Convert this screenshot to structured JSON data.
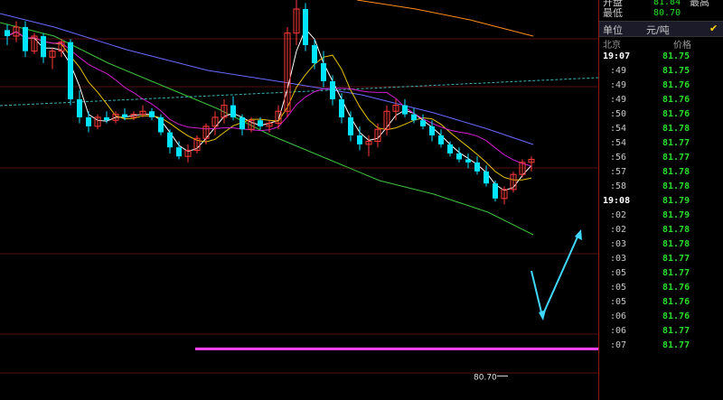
{
  "sidebar": {
    "open_label": "开盘",
    "open_value": "81.84",
    "open_extra": "最高",
    "low_label": "最低",
    "low_value": "80.70",
    "unit_label": "单位",
    "unit_value": "元/吨",
    "col_time": "北京",
    "col_price": "价格",
    "ticks": [
      {
        "time": "19:07",
        "price": "81.75",
        "major": true
      },
      {
        "time": ":49",
        "price": "81.75"
      },
      {
        "time": ":49",
        "price": "81.76"
      },
      {
        "time": ":49",
        "price": "81.76"
      },
      {
        "time": ":50",
        "price": "81.76"
      },
      {
        "time": ":54",
        "price": "81.78"
      },
      {
        "time": ":54",
        "price": "81.77"
      },
      {
        "time": ":56",
        "price": "81.77"
      },
      {
        "time": ":57",
        "price": "81.78"
      },
      {
        "time": ":58",
        "price": "81.78"
      },
      {
        "time": "19:08",
        "price": "81.79",
        "major": true
      },
      {
        "time": ":02",
        "price": "81.79"
      },
      {
        "time": ":02",
        "price": "81.78"
      },
      {
        "time": ":03",
        "price": "81.78"
      },
      {
        "time": ":03",
        "price": "81.77"
      },
      {
        "time": ":05",
        "price": "81.77"
      },
      {
        "time": ":05",
        "price": "81.76"
      },
      {
        "time": ":05",
        "price": "81.76"
      },
      {
        "time": ":06",
        "price": "81.76"
      },
      {
        "time": ":06",
        "price": "81.77"
      },
      {
        "time": ":07",
        "price": "81.77"
      }
    ]
  },
  "chart_data": {
    "type": "candlestick",
    "low_annotation": "80.70",
    "low_price": 80.7,
    "ylim": [
      80.62,
      81.95
    ],
    "colors": {
      "up": "#ff3b3b",
      "down": "#00e5ff",
      "ma1": "#ffffff",
      "ma2": "#e6c200",
      "ma3": "#d020d0",
      "ma4": "#3fc23f",
      "ma5": "#6a6aff",
      "ma6": "#ff8c1a",
      "support": "#ff44ff",
      "arrow": "#40d8ff"
    },
    "candles": [
      [
        81.85,
        81.87,
        81.8,
        81.83
      ],
      [
        81.83,
        81.88,
        81.81,
        81.86
      ],
      [
        81.86,
        81.88,
        81.76,
        81.78
      ],
      [
        81.78,
        81.84,
        81.77,
        81.83
      ],
      [
        81.83,
        81.84,
        81.74,
        81.76
      ],
      [
        81.76,
        81.79,
        81.72,
        81.78
      ],
      [
        81.78,
        81.82,
        81.76,
        81.81
      ],
      [
        81.81,
        81.82,
        81.6,
        81.62
      ],
      [
        81.62,
        81.65,
        81.54,
        81.56
      ],
      [
        81.56,
        81.58,
        81.51,
        81.53
      ],
      [
        81.53,
        81.57,
        81.52,
        81.56
      ],
      [
        81.56,
        81.58,
        81.54,
        81.55
      ],
      [
        81.55,
        81.58,
        81.54,
        81.57
      ],
      [
        81.57,
        81.59,
        81.55,
        81.56
      ],
      [
        81.56,
        81.58,
        81.55,
        81.57
      ],
      [
        81.57,
        81.6,
        81.56,
        81.58
      ],
      [
        81.58,
        81.59,
        81.55,
        81.56
      ],
      [
        81.56,
        81.57,
        81.5,
        81.51
      ],
      [
        81.51,
        81.52,
        81.44,
        81.46
      ],
      [
        81.46,
        81.48,
        81.42,
        81.43
      ],
      [
        81.43,
        81.47,
        81.41,
        81.45
      ],
      [
        81.45,
        81.5,
        81.44,
        81.49
      ],
      [
        81.49,
        81.54,
        81.47,
        81.53
      ],
      [
        81.53,
        81.58,
        81.5,
        81.56
      ],
      [
        81.56,
        81.62,
        81.54,
        81.6
      ],
      [
        81.6,
        81.63,
        81.55,
        81.56
      ],
      [
        81.56,
        81.57,
        81.5,
        81.52
      ],
      [
        81.52,
        81.56,
        81.51,
        81.55
      ],
      [
        81.55,
        81.56,
        81.52,
        81.53
      ],
      [
        81.53,
        81.55,
        81.51,
        81.54
      ],
      [
        81.54,
        81.6,
        81.52,
        81.58
      ],
      [
        81.58,
        81.86,
        81.56,
        81.84
      ],
      [
        81.84,
        81.96,
        81.8,
        81.92
      ],
      [
        81.92,
        81.94,
        81.78,
        81.8
      ],
      [
        81.8,
        81.82,
        81.72,
        81.74
      ],
      [
        81.74,
        81.78,
        81.66,
        81.68
      ],
      [
        81.68,
        81.7,
        81.6,
        81.62
      ],
      [
        81.62,
        81.64,
        81.54,
        81.56
      ],
      [
        81.56,
        81.58,
        81.48,
        81.5
      ],
      [
        81.5,
        81.53,
        81.45,
        81.47
      ],
      [
        81.47,
        81.5,
        81.43,
        81.48
      ],
      [
        81.48,
        81.54,
        81.46,
        81.52
      ],
      [
        81.52,
        81.6,
        81.5,
        81.58
      ],
      [
        81.58,
        81.62,
        81.55,
        81.6
      ],
      [
        81.6,
        81.62,
        81.56,
        81.57
      ],
      [
        81.57,
        81.59,
        81.54,
        81.55
      ],
      [
        81.55,
        81.57,
        81.52,
        81.53
      ],
      [
        81.53,
        81.55,
        81.48,
        81.5
      ],
      [
        81.5,
        81.52,
        81.46,
        81.47
      ],
      [
        81.47,
        81.48,
        81.43,
        81.44
      ],
      [
        81.44,
        81.46,
        81.41,
        81.42
      ],
      [
        81.42,
        81.44,
        81.39,
        81.41
      ],
      [
        81.41,
        81.43,
        81.37,
        81.38
      ],
      [
        81.38,
        81.4,
        81.33,
        81.34
      ],
      [
        81.34,
        81.35,
        81.28,
        81.29
      ],
      [
        81.29,
        81.33,
        81.27,
        81.32
      ],
      [
        81.32,
        81.38,
        81.31,
        81.37
      ],
      [
        81.37,
        81.42,
        81.36,
        81.41
      ],
      [
        81.41,
        81.43,
        81.38,
        81.42
      ]
    ]
  }
}
